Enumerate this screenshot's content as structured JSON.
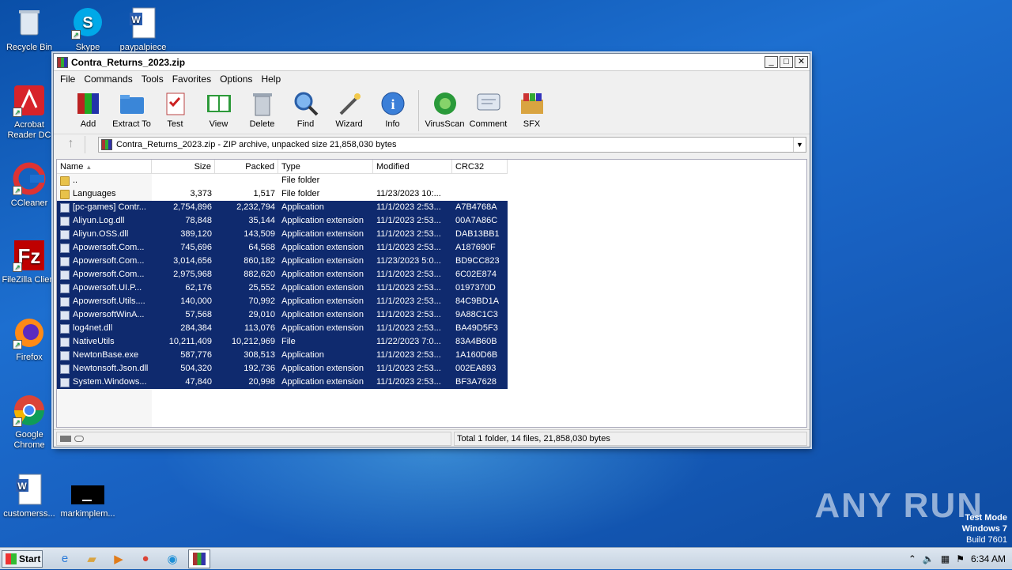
{
  "desktop": {
    "icons": [
      {
        "label": "Recycle Bin"
      },
      {
        "label": "Skype"
      },
      {
        "label": "paypalpiece"
      },
      {
        "label": "Acrobat Reader DC"
      },
      {
        "label": "CCleaner"
      },
      {
        "label": "FileZilla Client"
      },
      {
        "label": "Firefox"
      },
      {
        "label": "Google Chrome"
      },
      {
        "label": "customerss..."
      },
      {
        "label": "markimplem..."
      }
    ],
    "watermark": "ANY RUN",
    "test_mode": {
      "line1": "Test Mode",
      "line2": "Windows 7",
      "line3": "Build 7601"
    }
  },
  "window": {
    "title": "Contra_Returns_2023.zip",
    "menu": [
      "File",
      "Commands",
      "Tools",
      "Favorites",
      "Options",
      "Help"
    ],
    "toolbar": [
      "Add",
      "Extract To",
      "Test",
      "View",
      "Delete",
      "Find",
      "Wizard",
      "Info",
      "VirusScan",
      "Comment",
      "SFX"
    ],
    "address": "Contra_Returns_2023.zip - ZIP archive, unpacked size 21,858,030 bytes",
    "columns": {
      "name": "Name",
      "size": "Size",
      "packed": "Packed",
      "type": "Type",
      "modified": "Modified",
      "crc": "CRC32"
    },
    "rows": [
      {
        "name": "..",
        "size": "",
        "packed": "",
        "type": "File folder",
        "modified": "",
        "crc": "",
        "kind": "folder",
        "selected": false
      },
      {
        "name": "Languages",
        "size": "3,373",
        "packed": "1,517",
        "type": "File folder",
        "modified": "11/23/2023 10:...",
        "crc": "",
        "kind": "folder",
        "selected": false
      },
      {
        "name": "[pc-games] Contr...",
        "size": "2,754,896",
        "packed": "2,232,794",
        "type": "Application",
        "modified": "11/1/2023 2:53...",
        "crc": "A7B4768A",
        "kind": "file",
        "selected": true
      },
      {
        "name": "Aliyun.Log.dll",
        "size": "78,848",
        "packed": "35,144",
        "type": "Application extension",
        "modified": "11/1/2023 2:53...",
        "crc": "00A7A86C",
        "kind": "file",
        "selected": true
      },
      {
        "name": "Aliyun.OSS.dll",
        "size": "389,120",
        "packed": "143,509",
        "type": "Application extension",
        "modified": "11/1/2023 2:53...",
        "crc": "DAB13BB1",
        "kind": "file",
        "selected": true
      },
      {
        "name": "Apowersoft.Com...",
        "size": "745,696",
        "packed": "64,568",
        "type": "Application extension",
        "modified": "11/1/2023 2:53...",
        "crc": "A187690F",
        "kind": "file",
        "selected": true
      },
      {
        "name": "Apowersoft.Com...",
        "size": "3,014,656",
        "packed": "860,182",
        "type": "Application extension",
        "modified": "11/23/2023 5:0...",
        "crc": "BD9CC823",
        "kind": "file",
        "selected": true
      },
      {
        "name": "Apowersoft.Com...",
        "size": "2,975,968",
        "packed": "882,620",
        "type": "Application extension",
        "modified": "11/1/2023 2:53...",
        "crc": "6C02E874",
        "kind": "file",
        "selected": true
      },
      {
        "name": "Apowersoft.UI.P...",
        "size": "62,176",
        "packed": "25,552",
        "type": "Application extension",
        "modified": "11/1/2023 2:53...",
        "crc": "0197370D",
        "kind": "file",
        "selected": true
      },
      {
        "name": "Apowersoft.Utils....",
        "size": "140,000",
        "packed": "70,992",
        "type": "Application extension",
        "modified": "11/1/2023 2:53...",
        "crc": "84C9BD1A",
        "kind": "file",
        "selected": true
      },
      {
        "name": "ApowersoftWinA...",
        "size": "57,568",
        "packed": "29,010",
        "type": "Application extension",
        "modified": "11/1/2023 2:53...",
        "crc": "9A88C1C3",
        "kind": "file",
        "selected": true
      },
      {
        "name": "log4net.dll",
        "size": "284,384",
        "packed": "113,076",
        "type": "Application extension",
        "modified": "11/1/2023 2:53...",
        "crc": "BA49D5F3",
        "kind": "file",
        "selected": true
      },
      {
        "name": "NativeUtils",
        "size": "10,211,409",
        "packed": "10,212,969",
        "type": "File",
        "modified": "11/22/2023 7:0...",
        "crc": "83A4B60B",
        "kind": "file",
        "selected": true
      },
      {
        "name": "NewtonBase.exe",
        "size": "587,776",
        "packed": "308,513",
        "type": "Application",
        "modified": "11/1/2023 2:53...",
        "crc": "1A160D6B",
        "kind": "file",
        "selected": true
      },
      {
        "name": "Newtonsoft.Json.dll",
        "size": "504,320",
        "packed": "192,736",
        "type": "Application extension",
        "modified": "11/1/2023 2:53...",
        "crc": "002EA893",
        "kind": "file",
        "selected": true
      },
      {
        "name": "System.Windows...",
        "size": "47,840",
        "packed": "20,998",
        "type": "Application extension",
        "modified": "11/1/2023 2:53...",
        "crc": "BF3A7628",
        "kind": "file",
        "selected": true
      }
    ],
    "status": "Total 1 folder, 14 files, 21,858,030 bytes"
  },
  "taskbar": {
    "start_label": "Start",
    "clock": "6:34 AM"
  }
}
